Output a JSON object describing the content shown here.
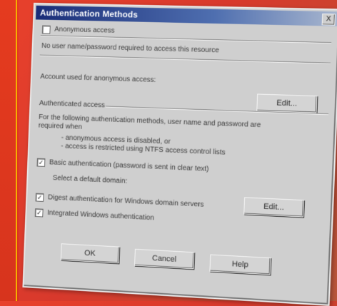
{
  "dialog": {
    "title": "Authentication Methods",
    "close_glyph": "X"
  },
  "anonymous": {
    "checkbox_label": "Anonymous access",
    "description": "No user name/password required to access this resource",
    "account_text": "Account used for anonymous access:",
    "edit_label": "Edit..."
  },
  "authenticated": {
    "header": "Authenticated access",
    "description_line1": "For the following authentication methods, user name and password are",
    "description_line2": "required when",
    "bullet1": "- anonymous access is disabled, or",
    "bullet2": "- access is restricted using NTFS access control lists"
  },
  "basic": {
    "checkbox_label": "Basic authentication (password is sent in clear text)",
    "domain_text": "Select a default domain:",
    "edit_label": "Edit..."
  },
  "digest": {
    "checkbox_label": "Digest authentication for Windows domain servers"
  },
  "integrated": {
    "checkbox_label": "Integrated Windows authentication"
  },
  "buttons": {
    "ok": "OK",
    "cancel": "Cancel",
    "help": "Help"
  },
  "check_glyph": "✓"
}
